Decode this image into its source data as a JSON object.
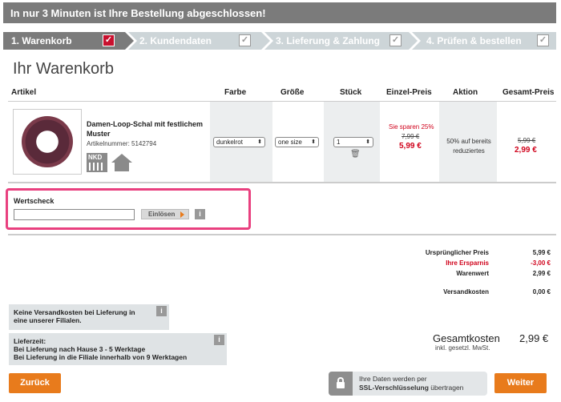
{
  "banner": {
    "title": "In nur 3 Minuten ist Ihre Bestellung abgeschlossen!"
  },
  "steps": [
    {
      "label": "1. Warenkorb",
      "active": true
    },
    {
      "label": "2. Kundendaten",
      "active": false
    },
    {
      "label": "3. Lieferung & Zahlung",
      "active": false
    },
    {
      "label": "4. Prüfen & bestellen",
      "active": false
    }
  ],
  "page_title": "Ihr Warenkorb",
  "table": {
    "headers": {
      "artikel": "Artikel",
      "farbe": "Farbe",
      "groesse": "Größe",
      "stueck": "Stück",
      "einzelpreis": "Einzel-Preis",
      "aktion": "Aktion",
      "gesamtpreis": "Gesamt-Preis"
    },
    "item": {
      "name": "Damen-Loop-Schal mit festlichem Muster",
      "article_number": "Artikelnummer: 5142794",
      "brand_badge": "NKD",
      "color": "dunkelrot",
      "size": "one size",
      "quantity": "1",
      "savings": "Sie sparen 25%",
      "old_unit_price": "7,99 €",
      "unit_price": "5,99 €",
      "action_text": "50% auf bereits reduziertes",
      "old_total_price": "5,99 €",
      "total_price": "2,99 €"
    }
  },
  "voucher": {
    "label": "Wertscheck",
    "input_value": "",
    "redeem_label": "Einlösen",
    "info": "i"
  },
  "summary": {
    "original_label": "Ursprünglicher Preis",
    "original_value": "5,99 €",
    "savings_label": "Ihre Ersparnis",
    "savings_value": "-3,00 €",
    "goods_label": "Warenwert",
    "goods_value": "2,99 €",
    "shipping_label": "Versandkosten",
    "shipping_value": "0,00 €",
    "total_label": "Gesamtkosten",
    "total_value": "2,99 €",
    "tax_note": "inkl. gesetzl. MwSt."
  },
  "notes": {
    "shipping_line1": "Keine Versandkosten bei Lieferung in",
    "shipping_line2": "eine unserer Filialen.",
    "delivery_title": "Lieferzeit:",
    "delivery_line1": "Bei Lieferung nach Hause 3 - 5 Werktage",
    "delivery_line2": "Bei Lieferung in die Filiale innerhalb von 9 Werktagen"
  },
  "buttons": {
    "back": "Zurück",
    "next": "Weiter"
  },
  "ssl": {
    "line1": "Ihre Daten werden per",
    "line2_bold": "SSL-Verschlüsselung",
    "line2_rest": " übertragen"
  },
  "colors": {
    "accent_orange": "#e87b1c",
    "price_red": "#d0021b",
    "highlight_pink": "#e9407f",
    "banner_gray": "#7b7b7b"
  }
}
